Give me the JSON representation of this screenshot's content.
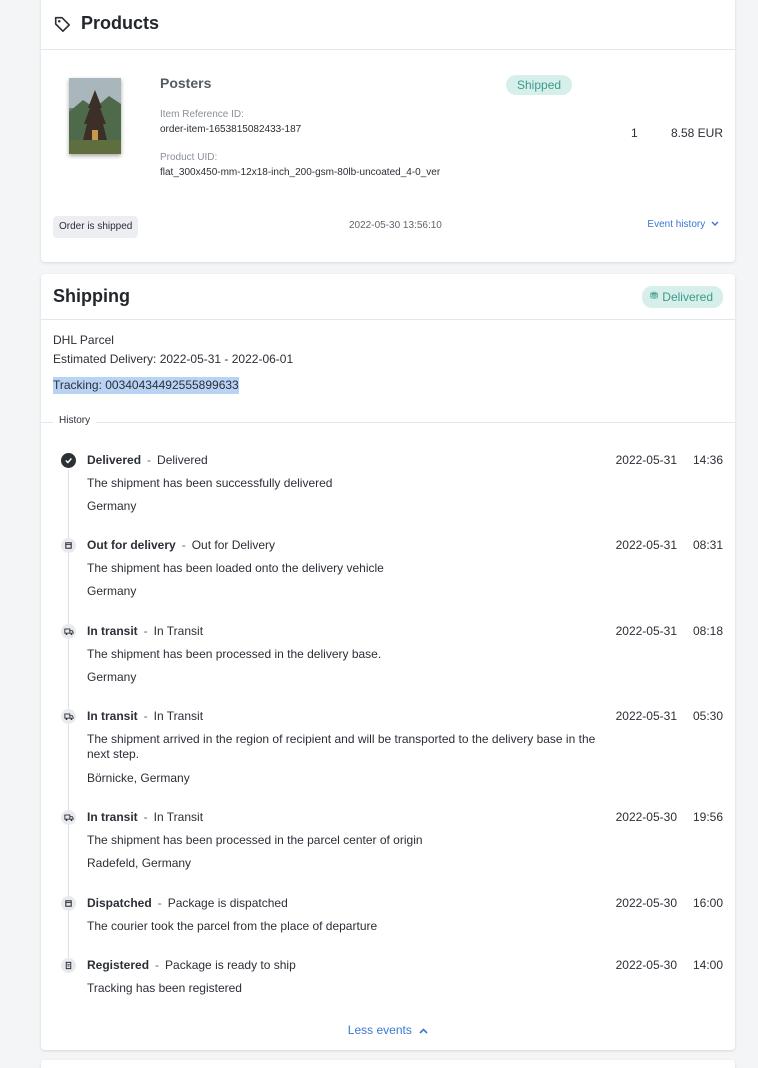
{
  "products": {
    "title": "Products",
    "item": {
      "name": "Posters",
      "status_badge": "Shipped",
      "ref_label": "Item Reference ID:",
      "ref_value": "order-item-1653815082433-187",
      "uid_label": "Product UID:",
      "uid_value": "flat_300x450-mm-12x18-inch_200-gsm-80lb-uncoated_4-0_ver",
      "quantity": "1",
      "price": "8.58 EUR"
    },
    "footer": {
      "status": "Order is shipped",
      "timestamp": "2022-05-30 13:56:10",
      "event_history_link": "Event history"
    }
  },
  "shipping": {
    "title": "Shipping",
    "status_badge": "Delivered",
    "carrier": "DHL Parcel",
    "estimated_delivery": "Estimated Delivery: 2022-05-31 - 2022-06-01",
    "tracking": "Tracking: 00340434492555899633",
    "history_label": "History",
    "events": [
      {
        "status": "Delivered",
        "detail": "Delivered",
        "description": "The shipment has been successfully delivered",
        "location": "Germany",
        "date": "2022-05-31",
        "time": "14:36",
        "icon": "delivered-icon"
      },
      {
        "status": "Out for delivery",
        "detail": "Out for Delivery",
        "description": "The shipment has been loaded onto the delivery vehicle",
        "location": "Germany",
        "date": "2022-05-31",
        "time": "08:31",
        "icon": "parcel-icon"
      },
      {
        "status": "In transit",
        "detail": "In Transit",
        "description": "The shipment has been processed in the delivery base.",
        "location": "Germany",
        "date": "2022-05-31",
        "time": "08:18",
        "icon": "truck-icon"
      },
      {
        "status": "In transit",
        "detail": "In Transit",
        "description": "The shipment arrived in the region of recipient and will be transported to the delivery base in the next step.",
        "location": "Börnicke, Germany",
        "date": "2022-05-31",
        "time": "05:30",
        "icon": "truck-icon"
      },
      {
        "status": "In transit",
        "detail": "In Transit",
        "description": "The shipment has been processed in the parcel center of origin",
        "location": "Radefeld, Germany",
        "date": "2022-05-30",
        "time": "19:56",
        "icon": "truck-icon"
      },
      {
        "status": "Dispatched",
        "detail": "Package is dispatched",
        "description": "The courier took the parcel from the place of departure",
        "location": "",
        "date": "2022-05-30",
        "time": "16:00",
        "icon": "parcel-icon"
      },
      {
        "status": "Registered",
        "detail": "Package is ready to ship",
        "description": "Tracking has been registered",
        "location": "",
        "date": "2022-05-30",
        "time": "14:00",
        "icon": "clipboard-icon"
      }
    ],
    "less_events_link": "Less events"
  },
  "colors": {
    "accent_link": "#3a78d4",
    "badge_text": "#3d9a8a",
    "badge_bg": "#d6efea",
    "tracking_highlight": "#b9d3f5"
  }
}
